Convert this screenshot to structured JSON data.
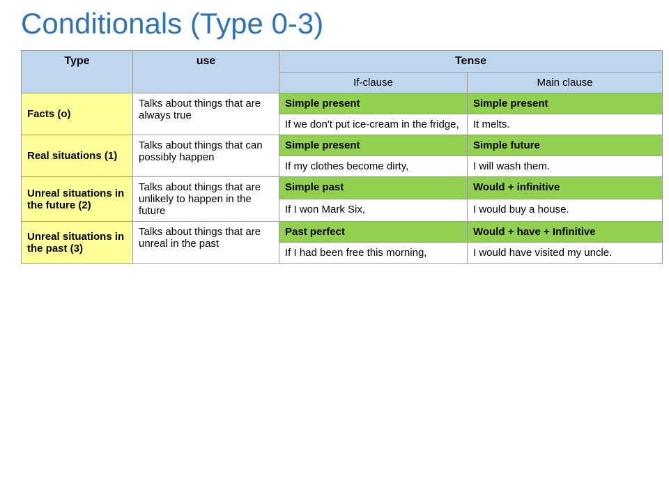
{
  "title": "Conditionals (Type 0-3)",
  "headers": {
    "type": "Type",
    "use": "use",
    "tense": "Tense",
    "if_clause": "If-clause",
    "main_clause": "Main clause"
  },
  "rows": [
    {
      "type": "Facts (o)",
      "use": "Talks about things that are always true",
      "tense_if_label": "Simple present",
      "tense_main_label": "Simple present",
      "tense_if_example": "If we don't put ice-cream in the fridge,",
      "tense_main_example": "It melts."
    },
    {
      "type": "Real situations (1)",
      "use": "Talks about things that can possibly happen",
      "tense_if_label": "Simple present",
      "tense_main_label": "Simple future",
      "tense_if_example": "If my clothes become dirty,",
      "tense_main_example": "I will wash them."
    },
    {
      "type": "Unreal situations in the future (2)",
      "use": "Talks about things that are unlikely to happen in the future",
      "tense_if_label": "Simple past",
      "tense_main_label": "Would + infinitive",
      "tense_if_example": "If I won Mark Six,",
      "tense_main_example": "I would buy a house."
    },
    {
      "type": "Unreal situations in the past (3)",
      "use": "Talks about things that are unreal in the past",
      "tense_if_label": "Past perfect",
      "tense_main_label": "Would + have + Infinitive",
      "tense_if_example": "If I had been free this morning,",
      "tense_main_example": "I  would have visited my uncle."
    }
  ]
}
